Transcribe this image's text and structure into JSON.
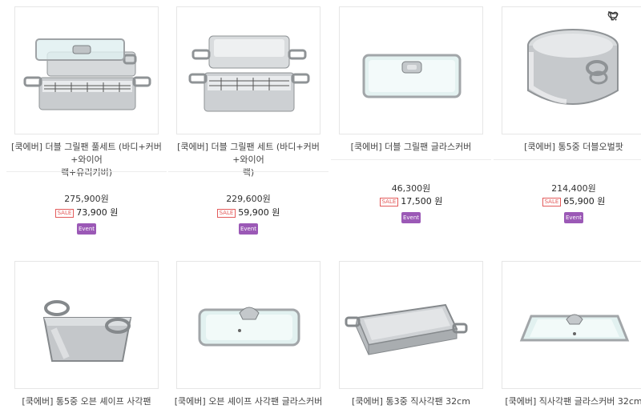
{
  "products": [
    {
      "title_line1": "[쿡에버] 더블 그릴팬 풀세트 (바디+커버+와이어",
      "title_line2": "랙+유리커버)",
      "price": "275,900원",
      "sale_label": "SALE",
      "sale_price": "73,900 원",
      "event_label": "Event"
    },
    {
      "title_line1": "[쿡에버] 더블 그릴팬 세트 (바디+커버+와이어",
      "title_line2": "랙)",
      "price": "229,600원",
      "sale_label": "SALE",
      "sale_price": "59,900 원",
      "event_label": "Event"
    },
    {
      "title_line1": "[쿡에버] 더블 그릴팬 글라스커버",
      "title_line2": "",
      "price": "46,300원",
      "sale_label": "SALE",
      "sale_price": "17,500 원",
      "event_label": "Event"
    },
    {
      "title_line1": "[쿡에버] 통5중 더블오벌팟",
      "title_line2": "",
      "price": "214,400원",
      "sale_label": "SALE",
      "sale_price": "65,900 원",
      "event_label": "Event"
    },
    {
      "title_line1": "[쿡에버] 통5중 오븐 셰이프 사각팬",
      "title_line2": ""
    },
    {
      "title_line1": "[쿡에버] 오븐 셰이프 사각팬 글라스커버",
      "title_line2": ""
    },
    {
      "title_line1": "[쿡에버] 통3중 직사각팬 32cm",
      "title_line2": ""
    },
    {
      "title_line1": "[쿡에버] 직사각팬 글라스커버 32cm",
      "title_line2": ""
    }
  ],
  "hover_icons": [
    "cart-icon",
    "heart-icon"
  ],
  "colors": {
    "event": "#9b59b6",
    "sale": "#e35b5b",
    "border": "#e6e6e6"
  }
}
